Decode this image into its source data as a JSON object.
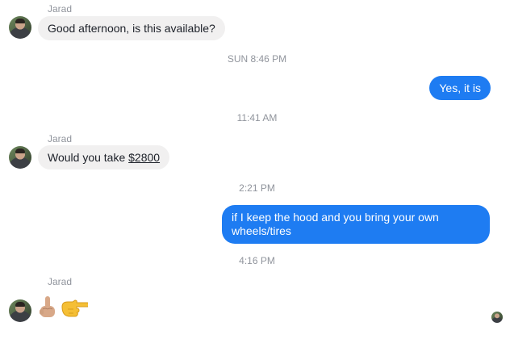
{
  "messages": {
    "m1": {
      "sender": "Jarad",
      "text": "Good afternoon, is this available?"
    },
    "t1": "SUN 8:46 PM",
    "m2": {
      "text": "Yes, it is"
    },
    "t2": "11:41 AM",
    "m3": {
      "sender": "Jarad",
      "prefix": "Would you take ",
      "price": "$2800"
    },
    "t3": "2:21 PM",
    "m4": {
      "text": "if I keep the hood and you bring your own wheels/tires"
    },
    "t4": "4:16 PM",
    "m5": {
      "sender": "Jarad",
      "emojis": [
        "middle-finger-emoji",
        "pointing-right-emoji"
      ]
    }
  },
  "colors": {
    "outgoing_bubble": "#1e7cf2",
    "incoming_bubble": "#f1f0f0",
    "meta_text": "#90949c"
  }
}
